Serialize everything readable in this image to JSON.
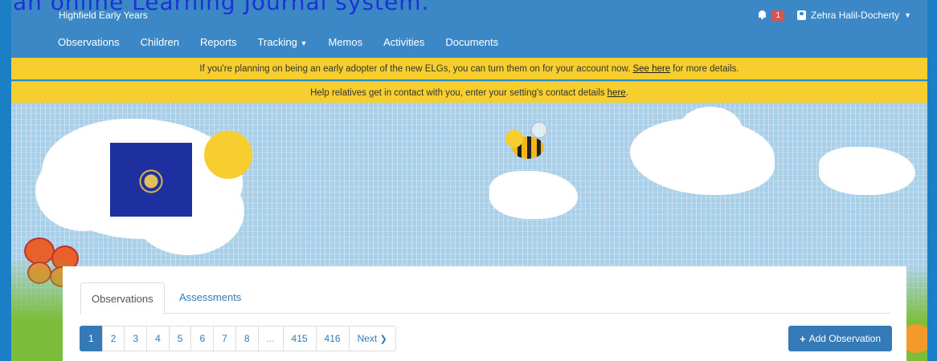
{
  "header": {
    "clipped_caption": "an online Learning Journal system.",
    "brand": "Highfield Early Years",
    "notification_count": "1",
    "user_name": "Zehra Halil-Docherty",
    "icons": [
      "bell-icon",
      "user-icon",
      "caret-down-icon"
    ]
  },
  "nav": {
    "items": [
      "Observations",
      "Children",
      "Reports",
      "Tracking",
      "Memos",
      "Activities",
      "Documents"
    ]
  },
  "banners": {
    "elg_pre": "If you're planning on being an early adopter of the new ELGs, you can turn them on for your account now.",
    "elg_link": "See here",
    "elg_post": "for more details.",
    "contact_pre": "Help relatives get in contact with you, enter your setting's contact details",
    "contact_link": "here",
    "contact_post": "."
  },
  "tabs": {
    "observations": "Observations",
    "assessments": "Assessments"
  },
  "pagination": {
    "pages": [
      "1",
      "2",
      "3",
      "4",
      "5",
      "6",
      "7",
      "8",
      "...",
      "415",
      "416"
    ],
    "current": "1",
    "next": "Next"
  },
  "actions": {
    "add_observation": "Add Observation"
  },
  "colors": {
    "nav_blue": "#3c88c6",
    "banner_yellow": "#f6cf2f",
    "primary": "#337ab7",
    "badge_red": "#d9534f"
  }
}
